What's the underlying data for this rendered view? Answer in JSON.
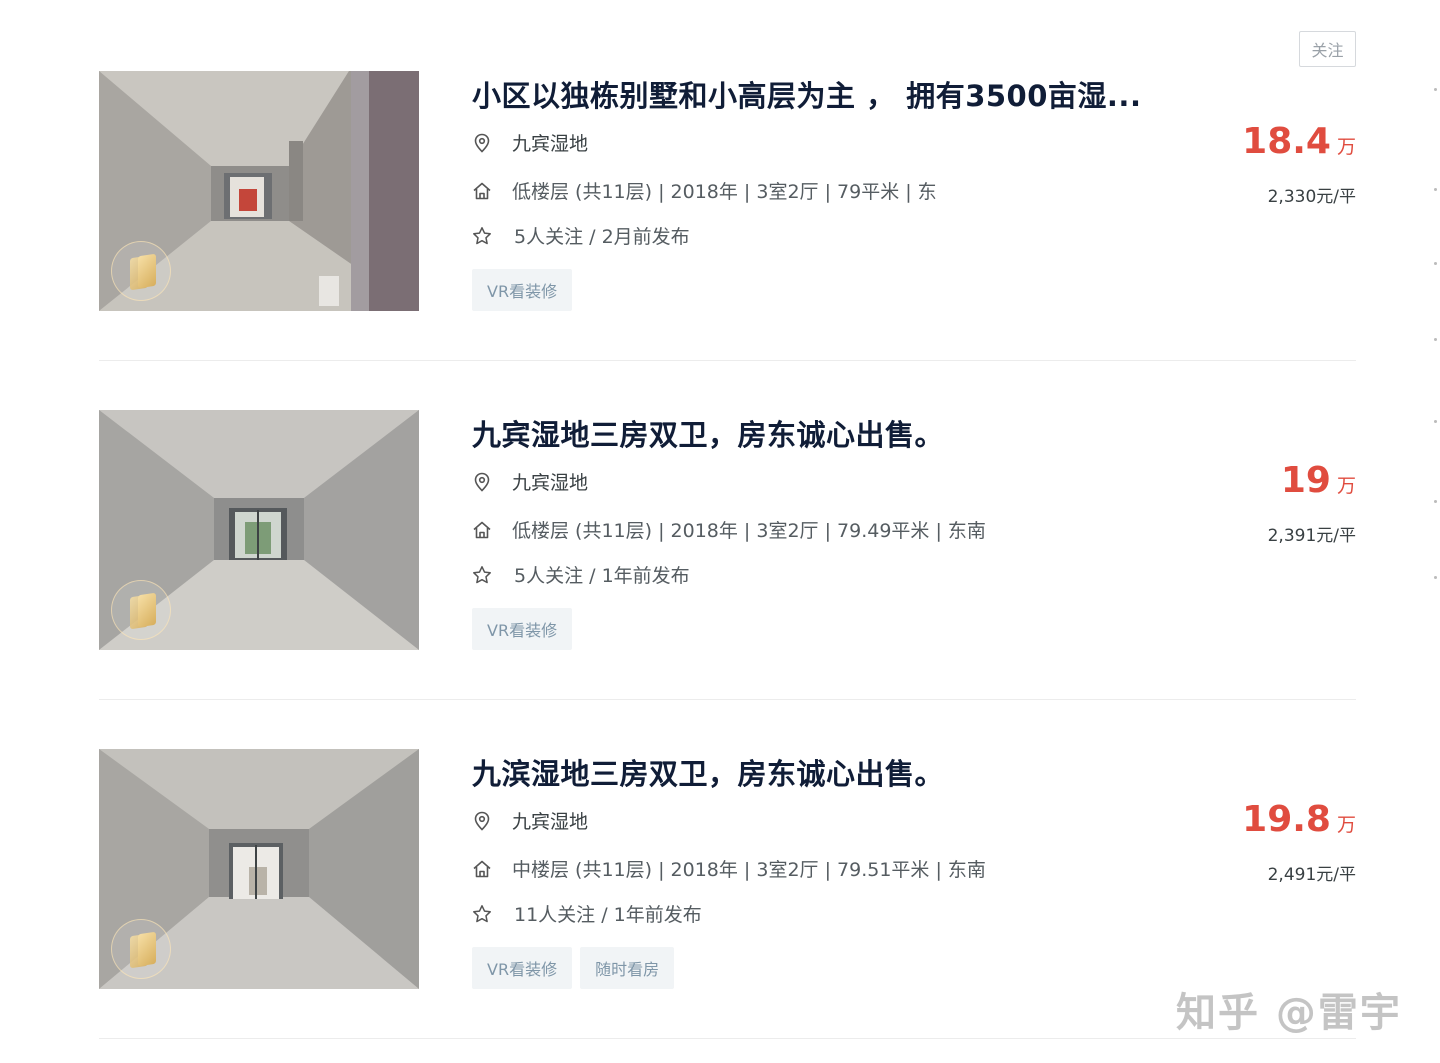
{
  "follow_button": "关注",
  "listings": [
    {
      "title": "小区以独栋别墅和小高层为主 ， 拥有3500亩湿...",
      "community": "九宾湿地",
      "info": "低楼层 (共11层) | 2018年 | 3室2厅 | 79平米 | 东",
      "follow": "5人关注 / 2月前发布",
      "tags": [
        "VR看装修"
      ],
      "price": "18.4",
      "price_unit": "万",
      "unit_price": "2,330元/平"
    },
    {
      "title": "九宾湿地三房双卫，房东诚心出售。",
      "community": "九宾湿地",
      "info": "低楼层 (共11层) | 2018年 | 3室2厅 | 79.49平米 | 东南",
      "follow": "5人关注 / 1年前发布",
      "tags": [
        "VR看装修"
      ],
      "price": "19",
      "price_unit": "万",
      "unit_price": "2,391元/平"
    },
    {
      "title": "九滨湿地三房双卫，房东诚心出售。",
      "community": "九宾湿地",
      "info": "中楼层 (共11层) | 2018年 | 3室2厅 | 79.51平米 | 东南",
      "follow": "11人关注 / 1年前发布",
      "tags": [
        "VR看装修",
        "随时看房"
      ],
      "price": "19.8",
      "price_unit": "万",
      "unit_price": "2,491元/平"
    }
  ],
  "watermark": "知乎 @雷宇",
  "colors": {
    "title": "#101d37",
    "price": "#e04c3f",
    "tag_bg": "#f1f4f6",
    "tag_text": "#7f96a8"
  },
  "icons": [
    "location-pin-icon",
    "house-icon",
    "star-icon",
    "vr-icon"
  ]
}
